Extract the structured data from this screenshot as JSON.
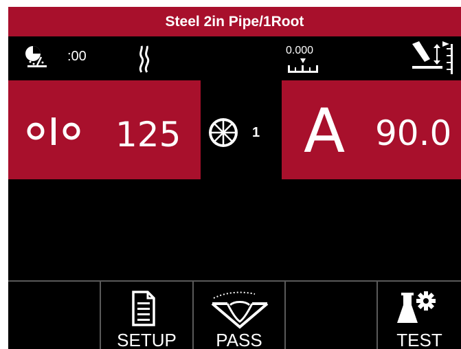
{
  "header": {
    "title": "Steel 2in Pipe/1Root"
  },
  "status_bar": {
    "timer_value": ":00",
    "scale_value": "0.000",
    "icons": [
      "timer-weld-icon",
      "gas-flow-icon",
      "scale-gauge-icon",
      "torch-height-icon"
    ]
  },
  "left_panel": {
    "icon": "wire-feed-speed-icon",
    "value": "125"
  },
  "trim": {
    "icon": "trim-wheel-icon",
    "value": "1"
  },
  "right_panel": {
    "unit": "A",
    "value": "90.0"
  },
  "softkeys": [
    {
      "label": "",
      "icon": ""
    },
    {
      "label": "SETUP",
      "icon": "document-icon"
    },
    {
      "label": "PASS",
      "icon": "weld-pass-icon"
    },
    {
      "label": "",
      "icon": ""
    },
    {
      "label": "TEST",
      "icon": "flask-gear-icon"
    }
  ],
  "colors": {
    "accent": "#a8102c",
    "background": "#000000",
    "divider": "#5a5a5a"
  }
}
